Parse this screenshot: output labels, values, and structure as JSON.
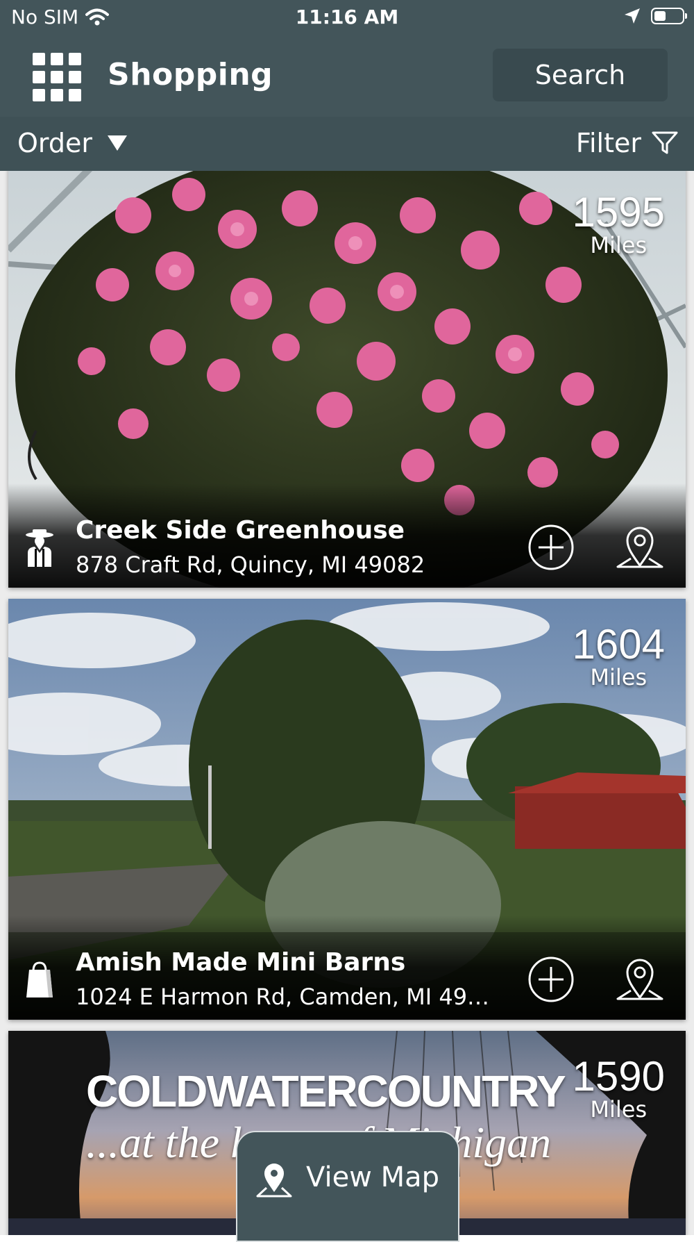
{
  "status_bar": {
    "carrier": "No SIM",
    "time": "11:16 AM"
  },
  "header": {
    "title": "Shopping",
    "search_label": "Search"
  },
  "toolbar": {
    "order_label": "Order",
    "filter_label": "Filter"
  },
  "listings": [
    {
      "name": "Creek Side Greenhouse",
      "address": "878 Craft Rd, Quincy, MI 49082",
      "distance": "1595",
      "unit": "Miles",
      "category_icon": "amish-person-icon"
    },
    {
      "name": "Amish Made Mini Barns",
      "address": "1024 E Harmon Rd, Camden, MI 492...",
      "distance": "1604",
      "unit": "Miles",
      "category_icon": "shopping-bag-icon"
    },
    {
      "name": "",
      "address": "",
      "distance": "1590",
      "unit": "Miles",
      "banner_text_1": "COLDWATERCOUNTRY",
      "banner_text_2": "...at the heart of Michigan"
    }
  ],
  "view_map_label": "View Map",
  "colors": {
    "header_bg": "#43555a",
    "toolbar_bg": "#3f5156",
    "search_bg": "#394a4f"
  }
}
